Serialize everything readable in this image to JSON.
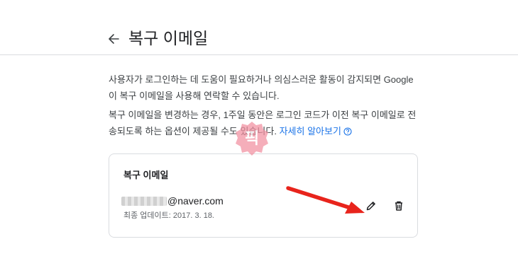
{
  "header": {
    "back_icon": "arrow-back-icon",
    "title": "복구 이메일"
  },
  "description": {
    "paragraph1": "사용자가 로그인하는 데 도움이 필요하거나 의심스러운 활동이 감지되면 Google이 복구 이메일을 사용해 연락할 수 있습니다.",
    "paragraph2": "복구 이메일을 변경하는 경우, 1주일 동안은 로그인 코드가 이전 복구 이메일로 전송되도록 하는 옵션이 제공될 수도 있습니다.",
    "learn_more": "자세히 알아보기",
    "help_icon": "help-circle-icon"
  },
  "card": {
    "title": "복구 이메일",
    "email_domain": "@naver.com",
    "updated": "최종 업데이트: 2017. 3. 18.",
    "edit_icon": "pencil-icon",
    "delete_icon": "trash-icon"
  },
  "annotation": {
    "color": "#e8241c",
    "watermark_glyph": "픽",
    "watermark_color": "#f28fa0"
  }
}
